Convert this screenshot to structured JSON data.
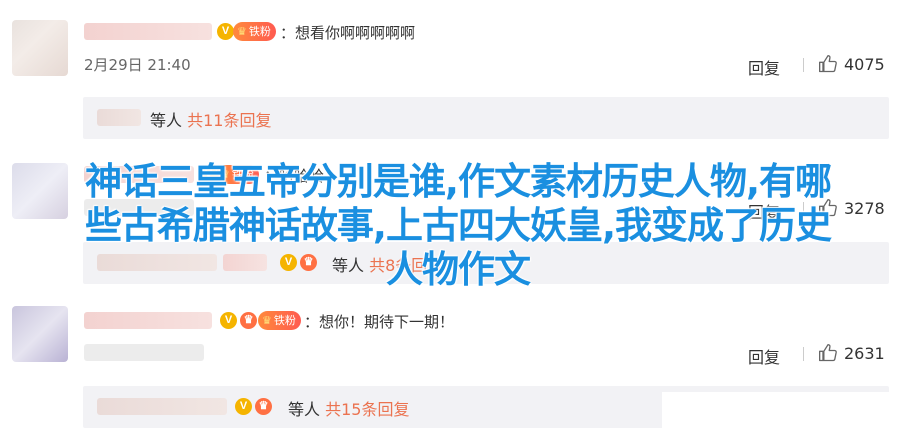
{
  "comments": [
    {
      "badge": "铁粉",
      "text": "：想看你啊啊啊啊啊",
      "time": "2月29日 21:40",
      "reply_label": "回复",
      "likes": "4075",
      "replies": {
        "who": "等人",
        "count": "共11条回复"
      }
    },
    {
      "badge": "铁粉",
      "text": "：哈哈哈",
      "reply_label": "回复",
      "likes": "3278",
      "replies": {
        "who": "等人",
        "count": "共8条回复"
      }
    },
    {
      "badge": "铁粉",
      "text": "：想你！期待下一期！",
      "reply_label": "回复",
      "likes": "2631",
      "replies": {
        "who": "等人",
        "count": "共15条回复"
      }
    }
  ],
  "overlay_title": {
    "line1": "神话三皇五帝分别是谁,作文素材历史人物,有哪",
    "line2": "些古希腊神话故事,上古四大妖皇,我变成了历史",
    "line3": "人物作文"
  },
  "colors": {
    "accent": "#eb7350",
    "overlay": "#1a8fe0",
    "fan_badge": "#ff6a45"
  },
  "icons": [
    "thumb-up-icon",
    "verified-v-icon",
    "crown-icon"
  ]
}
